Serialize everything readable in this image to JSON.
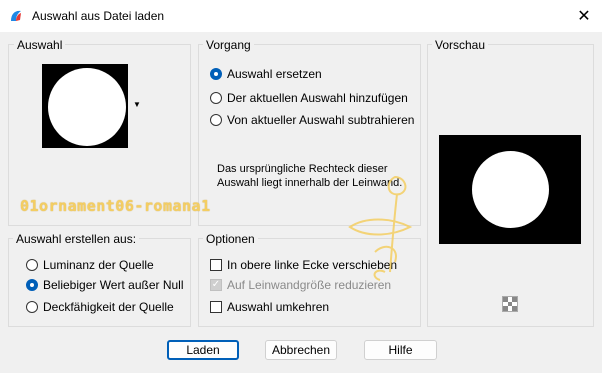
{
  "window": {
    "title": "Auswahl aus Datei laden"
  },
  "groups": {
    "auswahl": "Auswahl",
    "vorgang": "Vorgang",
    "vorschau": "Vorschau",
    "erstellen": "Auswahl erstellen aus:",
    "optionen": "Optionen"
  },
  "vorgang": {
    "options": [
      "Auswahl ersetzen",
      "Der aktuellen Auswahl hinzufügen",
      "Von aktueller Auswahl subtrahieren"
    ],
    "selected": 0,
    "info": "Das ursprüngliche Rechteck dieser Auswahl liegt innerhalb der Leinwand."
  },
  "erstellen": {
    "options": [
      "Luminanz der Quelle",
      "Beliebiger Wert außer Null",
      "Deckfähigkeit der Quelle"
    ],
    "selected": 1
  },
  "optionen": {
    "items": [
      "In obere linke Ecke verschieben",
      "Auf Leinwandgröße reduzieren",
      "Auswahl umkehren"
    ]
  },
  "watermark": "01ornament06-romana1",
  "buttons": {
    "laden": "Laden",
    "abbrechen": "Abbrechen",
    "hilfe": "Hilfe"
  },
  "colors": {
    "accent": "#005fb8",
    "watermark": "#f4ce62"
  }
}
